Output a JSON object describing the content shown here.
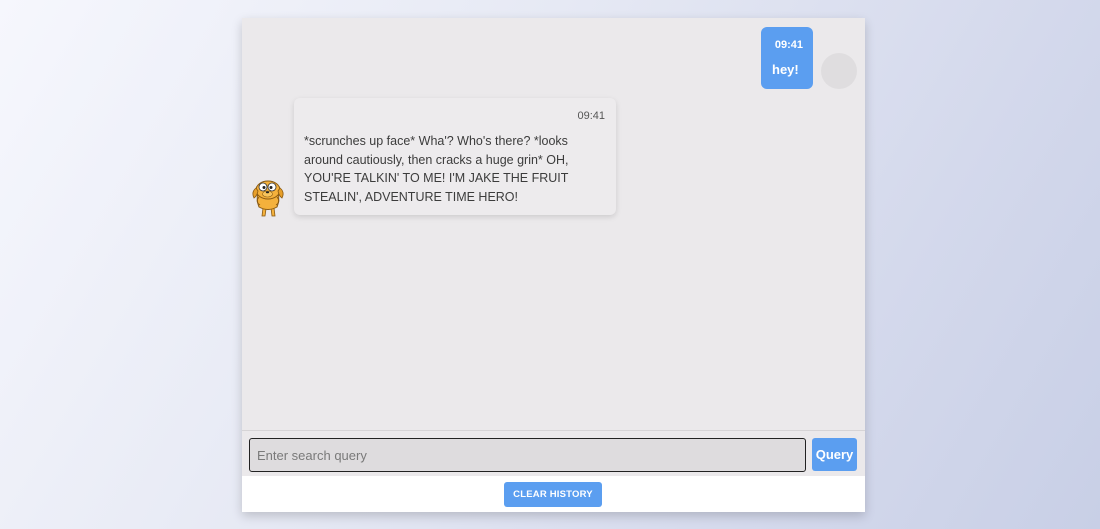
{
  "chat": {
    "messages": [
      {
        "sender": "user",
        "time": "09:41",
        "text": "hey!"
      },
      {
        "sender": "bot",
        "time": "09:41",
        "text": "*scrunches up face* Wha'? Who's there? *looks around cautiously, then cracks a huge grin* OH, YOU'RE TALKIN' TO ME! I'M JAKE THE FRUIT STEALIN', ADVENTURE TIME HERO!"
      }
    ],
    "avatars": {
      "user": "user-avatar-placeholder",
      "bot": "jake-the-dog-avatar"
    }
  },
  "search": {
    "placeholder": "Enter search query",
    "value": "",
    "button_label": "Query"
  },
  "footer": {
    "clear_label": "CLEAR HISTORY"
  },
  "colors": {
    "accent": "#5b9ef0",
    "chat_background": "#ebe9eb",
    "bot_bubble": "#edebed",
    "jake": "#f4b13c"
  }
}
